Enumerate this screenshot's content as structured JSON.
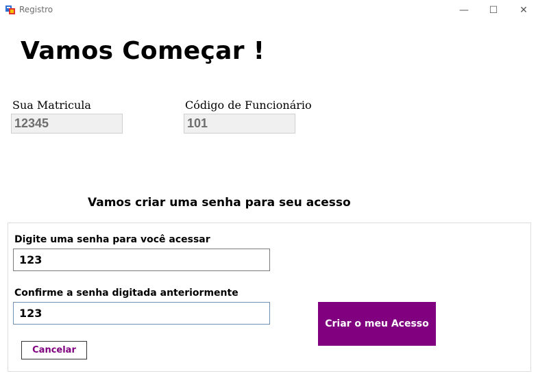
{
  "window": {
    "title": "Registro",
    "icon": "app-form-icon",
    "controls": {
      "minimize": "—",
      "maximize": "☐",
      "close": "✕"
    }
  },
  "heading": "Vamos Começar !",
  "fields": {
    "matricula_label": "Sua Matricula",
    "matricula_value": "12345",
    "codigo_label": "Código de Funcionário",
    "codigo_value": "101"
  },
  "password_section": {
    "title": "Vamos criar uma senha para seu acesso",
    "password_label": "Digite uma senha para você acessar",
    "password_value": "123",
    "confirm_label": "Confirme a senha digitada anteriormente",
    "confirm_value": "123"
  },
  "buttons": {
    "create": "Criar o meu Acesso",
    "cancel": "Cancelar"
  },
  "colors": {
    "accent": "#800080",
    "readonly_bg": "#f0f0f0",
    "readonly_text": "#6d6d6d"
  }
}
